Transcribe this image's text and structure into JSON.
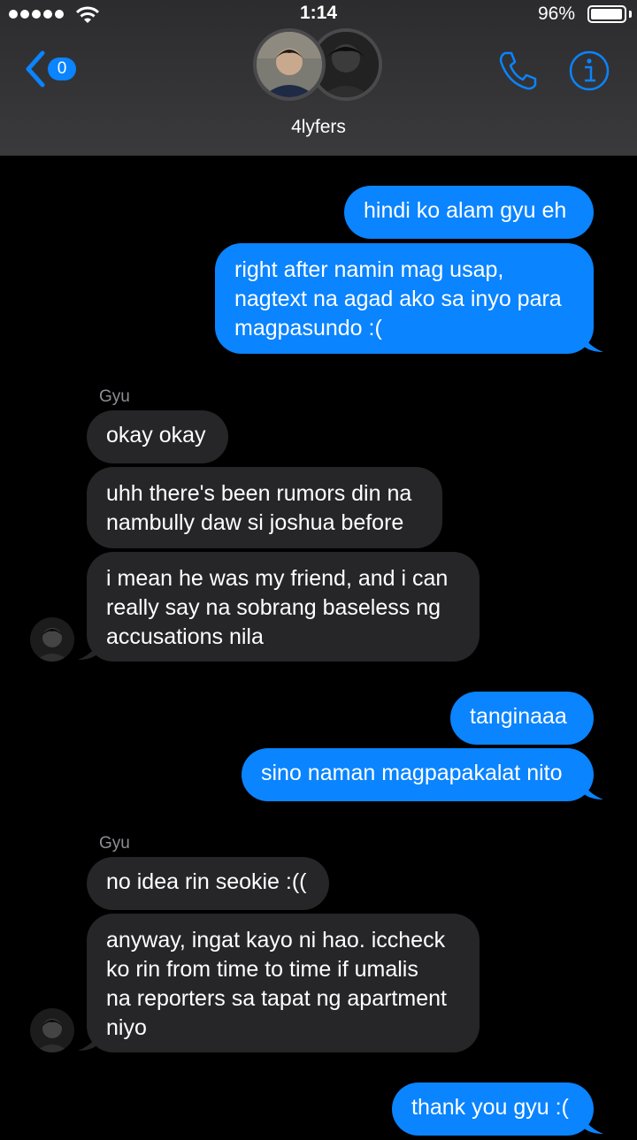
{
  "status_bar": {
    "time": "1:14",
    "battery_percent": "96%",
    "battery_level": 0.96,
    "signal_dots": 5
  },
  "header": {
    "unread_count": "0",
    "conversation_title": "4lyfers",
    "accent_color": "#0a84ff"
  },
  "messages": [
    {
      "type": "sent",
      "text": "hindi ko alam gyu eh"
    },
    {
      "type": "sent",
      "text": "right after namin mag usap,\nnagtext na agad ako sa inyo para\nmagpasundo :("
    },
    {
      "type": "sender",
      "text": "Gyu"
    },
    {
      "type": "received",
      "text": "okay okay"
    },
    {
      "type": "received",
      "text": "uhh there's been rumors din na\nnambully daw si joshua before"
    },
    {
      "type": "received",
      "text": "i mean he was my friend, and i can\nreally say na sobrang baseless ng\naccusations nila"
    },
    {
      "type": "sent",
      "text": "tanginaaa"
    },
    {
      "type": "sent",
      "text": "sino naman magpapakalat nito"
    },
    {
      "type": "sender",
      "text": "Gyu"
    },
    {
      "type": "received",
      "text": "no idea rin seokie :(("
    },
    {
      "type": "received",
      "text": "anyway, ingat kayo ni hao. iccheck\nko rin from time to time if umalis\nna reporters sa tapat ng apartment\nniyo"
    },
    {
      "type": "sent",
      "text": "thank you gyu :("
    }
  ]
}
